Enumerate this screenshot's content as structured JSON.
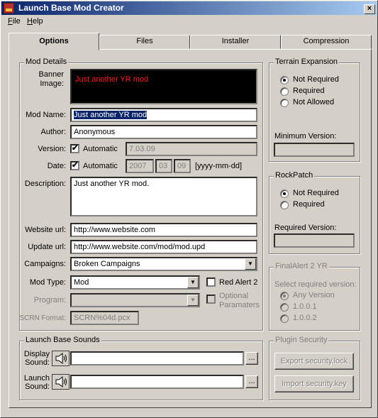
{
  "window": {
    "title": "Launch Base Mod Creator",
    "close_glyph": "×"
  },
  "menu": [
    {
      "label": "File",
      "mnemonic": "F"
    },
    {
      "label": "Help",
      "mnemonic": "H"
    }
  ],
  "tabs": [
    "Options",
    "Files",
    "Installer",
    "Compression"
  ],
  "mod_details": {
    "legend": "Mod Details",
    "banner_label": "Banner Image:",
    "banner_text": "Just another YR mod",
    "mod_name_label": "Mod Name:",
    "mod_name": "Just another YR mod",
    "author_label": "Author:",
    "author": "Anonymous",
    "version_label": "Version:",
    "version_auto_label": "Automatic",
    "version_value": "7.03.09",
    "date_label": "Date:",
    "date_auto_label": "Automatic",
    "date_year": "2007",
    "date_month": "03",
    "date_day": "09",
    "date_format": "[yyyy-mm-dd]",
    "description_label": "Description:",
    "description": "Just another YR mod.",
    "website_label": "Website url:",
    "website": "http://www.website.com",
    "update_label": "Update url:",
    "update": "http://www.website.com/mod/mod.upd",
    "campaigns_label": "Campaigns:",
    "campaigns": "Broken Campaigns",
    "mod_type_label": "Mod Type:",
    "mod_type": "Mod",
    "red_alert_label": "Red Alert 2",
    "program_label": "Program:",
    "optional_params_label": "Optional Paramaters",
    "scrn_label": "SCRN Format:",
    "scrn_format": "SCRN%04d.pcx"
  },
  "terrain": {
    "legend": "Terrain Expansion",
    "options": [
      "Not Required",
      "Required",
      "Not Allowed"
    ],
    "selected": "Not Required",
    "min_version_label": "Minimum Version:"
  },
  "rockpatch": {
    "legend": "RockPatch",
    "options": [
      "Not Required",
      "Required"
    ],
    "selected": "Not Required",
    "req_version_label": "Required Version:"
  },
  "finalalert": {
    "legend": "FinalAlert 2 YR",
    "select_label": "Select required version:",
    "options": [
      "Any Version",
      "1.0.0.1",
      "1.0.0.2"
    ],
    "selected": "Any Version"
  },
  "sounds": {
    "legend": "Launch Base Sounds",
    "display_label": "Display Sound:",
    "launch_label": "Launch Sound:",
    "browse_label": "..."
  },
  "plugin": {
    "legend": "Plugin Security",
    "export_label": "Export security.lock",
    "import_label": "Import security.key"
  },
  "checkmark": "✔",
  "dropdown_glyph": "▼"
}
